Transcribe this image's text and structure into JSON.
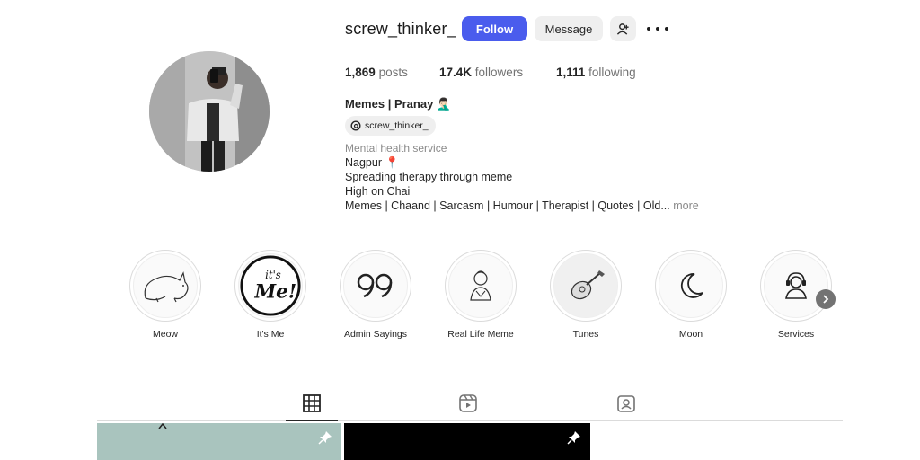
{
  "profile": {
    "username": "screw_thinker_",
    "follow_label": "Follow",
    "message_label": "Message",
    "posts_count": "1,869",
    "posts_label": "posts",
    "followers_count": "17.4K",
    "followers_label": "followers",
    "following_count": "1,111",
    "following_label": "following",
    "full_name": "Memes | Pranay 🤦🏻‍♂️",
    "threads_handle": "screw_thinker_",
    "category": "Mental health service",
    "bio_lines": [
      "Nagpur 📍",
      "Spreading therapy through meme",
      "High on Chai",
      "Memes | Chaand | Sarcasm | Humour | Therapist | Quotes | Old..."
    ],
    "bio_more": "more"
  },
  "highlights": [
    {
      "label": "Meow",
      "icon": "cat-sketch"
    },
    {
      "label": "It's Me",
      "icon": "its-me-text"
    },
    {
      "label": "Admin Sayings",
      "icon": "quote-marks"
    },
    {
      "label": "Real Life Meme",
      "icon": "person-sketch"
    },
    {
      "label": "Tunes",
      "icon": "guitar-sketch"
    },
    {
      "label": "Moon",
      "icon": "crescent-moon"
    },
    {
      "label": "Services",
      "icon": "support-agent"
    }
  ],
  "tabs": [
    {
      "name": "posts",
      "icon": "grid-icon",
      "active": true
    },
    {
      "name": "reels",
      "icon": "reels-icon",
      "active": false
    },
    {
      "name": "tagged",
      "icon": "tagged-icon",
      "active": false
    }
  ],
  "colors": {
    "follow_button": "#4a5ced",
    "secondary_button": "#efefef",
    "muted_text": "#737373"
  }
}
